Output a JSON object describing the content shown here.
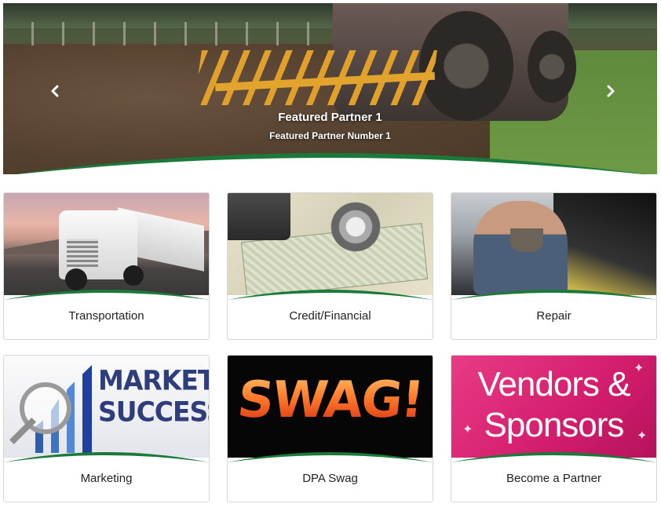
{
  "carousel": {
    "title": "Featured Partner 1",
    "subtitle": "Featured Partner Number 1",
    "prev_icon": "chevron-left-icon",
    "next_icon": "chevron-right-icon",
    "image": "tractor-plowing-field"
  },
  "colors": {
    "accent_green": "#1b7a3a",
    "card_border": "#d7d7d7",
    "label_text": "#222222"
  },
  "cards": [
    {
      "label": "Transportation",
      "image": "semi-truck"
    },
    {
      "label": "Credit/Financial",
      "image": "money-stethoscope"
    },
    {
      "label": "Repair",
      "image": "mechanic"
    },
    {
      "label": "Marketing",
      "image": "marketing-success"
    },
    {
      "label": "DPA Swag",
      "image": "swag"
    },
    {
      "label": "Become a Partner",
      "image": "vendors-sponsors"
    }
  ],
  "images": {
    "marketing_line1": "MARKETING",
    "marketing_line2": "SUCCESS",
    "swag_text": "SWAG!",
    "vendors_line1": "Vendors &",
    "vendors_line2": "Sponsors"
  }
}
